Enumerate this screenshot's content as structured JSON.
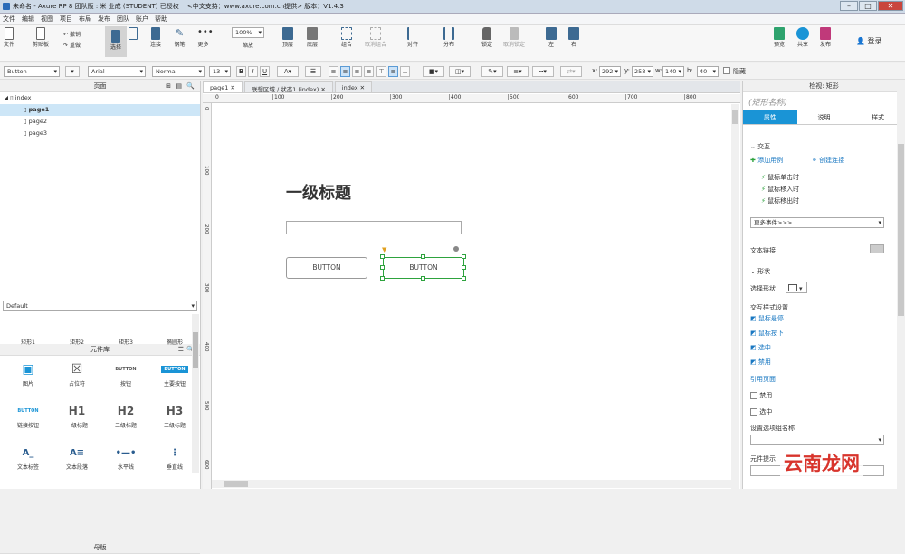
{
  "window": {
    "title": "未命名 - Axure RP 8 团队版 : 米 业成 (STUDENT) 已授权　 <中文支持：www.axure.com.cn提供> 版本：V1.4.3"
  },
  "menu": [
    "文件",
    "编辑",
    "视图",
    "项目",
    "布局",
    "发布",
    "团队",
    "账户",
    "帮助"
  ],
  "toolbar": {
    "file": "文件",
    "clipboard": "剪贴板",
    "undo": "撤销",
    "redo": "重做",
    "select": "选择",
    "connect": "连接",
    "pen": "钢笔",
    "more": "更多",
    "zoom_value": "100%",
    "zoom_label": "缩放",
    "top": "顶层",
    "bottom": "底层",
    "group": "组合",
    "ungroup": "取消组合",
    "align": "对齐",
    "distribute": "分布",
    "lock": "锁定",
    "unlock": "取消锁定",
    "left": "左",
    "right": "右",
    "preview": "预览",
    "share": "共享",
    "publish": "发布",
    "login": "登录"
  },
  "format": {
    "widget_type": "Button",
    "font": "Arial",
    "weight": "Normal",
    "size": "13",
    "bold": "B",
    "italic": "I",
    "underline": "U",
    "x_label": "x:",
    "x": "292",
    "y_label": "y:",
    "y": "258",
    "w_label": "w:",
    "w": "140",
    "h_label": "h:",
    "h": "40",
    "hide_label": "隐藏"
  },
  "pages": {
    "title": "页面",
    "items": [
      {
        "name": "index"
      },
      {
        "name": "page1"
      },
      {
        "name": "page2"
      },
      {
        "name": "page3"
      }
    ]
  },
  "library": {
    "title": "元件库",
    "selected": "Default",
    "items": [
      {
        "label": "矩形1",
        "icon": ""
      },
      {
        "label": "矩形2",
        "icon": ""
      },
      {
        "label": "矩形3",
        "icon": ""
      },
      {
        "label": "椭圆形",
        "icon": ""
      },
      {
        "label": "图片",
        "icon": "▣"
      },
      {
        "label": "占位符",
        "icon": "☒"
      },
      {
        "label": "按钮",
        "icon": "BUTTON"
      },
      {
        "label": "主要按钮",
        "icon": "BUTTON"
      },
      {
        "label": "链接按钮",
        "icon": "BUTTON"
      },
      {
        "label": "一级标题",
        "icon": "H1"
      },
      {
        "label": "二级标题",
        "icon": "H2"
      },
      {
        "label": "三级标题",
        "icon": "H3"
      },
      {
        "label": "文本标签",
        "icon": "A_"
      },
      {
        "label": "文本段落",
        "icon": "A≡"
      },
      {
        "label": "水平线",
        "icon": "•—•"
      },
      {
        "label": "垂直线",
        "icon": "⋮"
      }
    ]
  },
  "masters": {
    "title": "母版"
  },
  "tabs": [
    {
      "label": "page1"
    },
    {
      "label": "联想区域 / 状态1 (index)"
    },
    {
      "label": "index"
    }
  ],
  "ruler_h": [
    "0",
    "100",
    "200",
    "300",
    "400",
    "500",
    "600",
    "700",
    "800"
  ],
  "ruler_v": [
    "0",
    "100",
    "200",
    "300",
    "400",
    "500",
    "600"
  ],
  "canvas": {
    "heading": "一级标题",
    "button1": "BUTTON",
    "button2": "BUTTON"
  },
  "inspector": {
    "title": "检视: 矩形",
    "name_placeholder": "(矩形名称)",
    "tabs": [
      "属性",
      "说明",
      "样式"
    ],
    "interaction": "交互",
    "add_case": "添加用例",
    "create_link": "创建连接",
    "events": [
      "鼠标单击时",
      "鼠标移入时",
      "鼠标移出时"
    ],
    "more_events": "更多事件>>>",
    "text_link": "文本链接",
    "shape": "形状",
    "select_shape": "选择形状",
    "interaction_styles": "交互样式设置",
    "hover": "鼠标悬停",
    "mousedown": "鼠标按下",
    "selected": "选中",
    "disabled": "禁用",
    "ref_page": "引用页面",
    "disabled_cb": "禁用",
    "selected_cb": "选中",
    "group_name": "设置选项组名称",
    "tooltip": "元件提示"
  },
  "watermark": "云南龙网"
}
